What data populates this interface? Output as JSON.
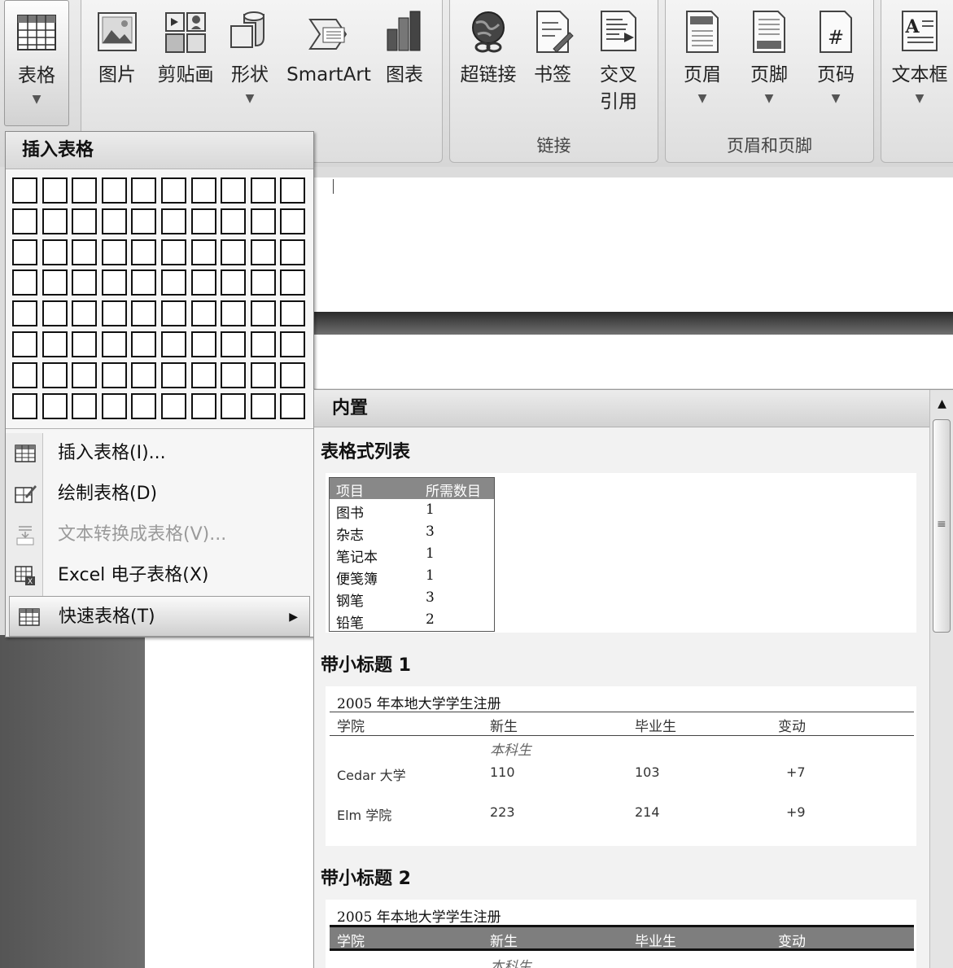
{
  "ribbon": {
    "table_button": {
      "label": "表格"
    },
    "buttons": [
      {
        "label": "图片"
      },
      {
        "label": "剪贴画"
      },
      {
        "label": "形状"
      },
      {
        "label": "SmartArt"
      },
      {
        "label": "图表"
      },
      {
        "label": "超链接"
      },
      {
        "label": "书签"
      },
      {
        "label": "交叉"
      },
      {
        "label": "引用"
      },
      {
        "label": "页眉"
      },
      {
        "label": "页脚"
      },
      {
        "label": "页码"
      },
      {
        "label": "文本框"
      }
    ],
    "groups": {
      "links": "链接",
      "header_footer": "页眉和页脚"
    }
  },
  "dropdown": {
    "title": "插入表格",
    "grid": {
      "cols": 10,
      "rows": 8
    },
    "menu": [
      {
        "label": "插入表格(I)...",
        "icon": "insert-table-icon",
        "enabled": true
      },
      {
        "label": "绘制表格(D)",
        "icon": "draw-table-icon",
        "enabled": true
      },
      {
        "label": "文本转换成表格(V)...",
        "icon": "convert-text-icon",
        "enabled": false
      },
      {
        "label": "Excel 电子表格(X)",
        "icon": "excel-sheet-icon",
        "enabled": true
      },
      {
        "label": "快速表格(T)",
        "icon": "quick-table-icon",
        "enabled": true,
        "highlighted": true
      }
    ]
  },
  "quick_tables": {
    "header": "内置",
    "sections": [
      {
        "title": "表格式列表",
        "table": {
          "columns": [
            "项目",
            "所需数目"
          ],
          "rows": [
            [
              "图书",
              "1"
            ],
            [
              "杂志",
              "3"
            ],
            [
              "笔记本",
              "1"
            ],
            [
              "便笺簿",
              "1"
            ],
            [
              "钢笔",
              "3"
            ],
            [
              "铅笔",
              "2"
            ]
          ]
        }
      },
      {
        "title": "带小标题 1",
        "caption": "2005 年本地大学学生注册",
        "columns": [
          "学院",
          "新生",
          "毕业生",
          "变动"
        ],
        "subheading": "本科生",
        "rows": [
          [
            "Cedar 大学",
            "110",
            "103",
            "+7"
          ],
          [
            "Elm 学院",
            "223",
            "214",
            "+9"
          ]
        ]
      },
      {
        "title": "带小标题 2",
        "caption": "2005 年本地大学学生注册",
        "columns": [
          "学院",
          "新生",
          "毕业生",
          "变动"
        ],
        "subheading": "本科生"
      }
    ]
  }
}
